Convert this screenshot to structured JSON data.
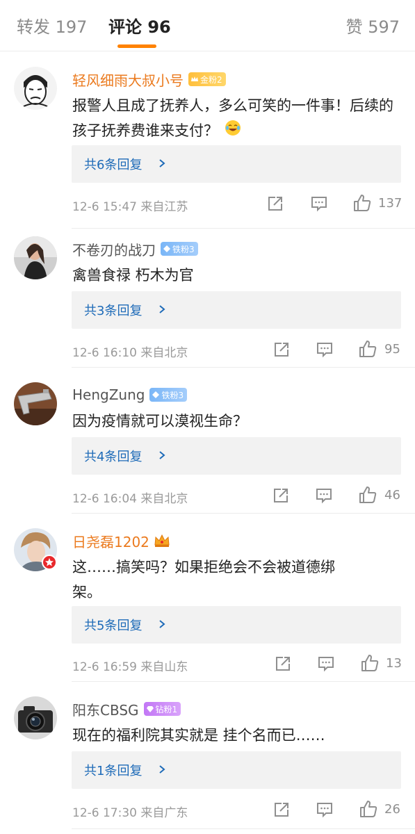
{
  "tabs": {
    "repost": "转发 197",
    "comments": "评论 96",
    "likes": "赞 597",
    "accent": "#ff8200"
  },
  "comments": [
    {
      "username": "轻风细雨大叔小号",
      "badge": "金粉2",
      "badge_type": "gold",
      "text": "报警人且成了抚养人，多么可笑的一件事！后续的孩子抚养费谁来支付？",
      "emoji": "laugh-cry-emoji",
      "replies": "共6条回复",
      "meta": "12-6 15:47 来自江苏",
      "likes": "137"
    },
    {
      "username": "不卷刃的战刀",
      "badge": "铁粉3",
      "badge_type": "iron",
      "text": "禽兽食禄 朽木为官",
      "replies": "共3条回复",
      "meta": "12-6 16:10 来自北京",
      "likes": "95"
    },
    {
      "username": "HengZung",
      "badge": "铁粉3",
      "badge_type": "iron",
      "text": "因为疫情就可以漠视生命？",
      "replies": "共4条回复",
      "meta": "12-6 16:04 来自北京",
      "likes": "46"
    },
    {
      "username": "日尧磊1202",
      "badge_type": "crown",
      "text_line1": "这……搞笑吗？如果拒绝会不会被道德绑",
      "text_line2": "架。",
      "replies": "共5条回复",
      "meta": "12-6 16:59 来自山东",
      "likes": "13"
    },
    {
      "username": "阳东CBSG",
      "badge": "钻粉1",
      "badge_type": "diamond",
      "text": "现在的福利院其实就是 挂个名而已……",
      "replies": "共1条回复",
      "meta": "12-6 17:30 来自广东",
      "likes": "26"
    }
  ]
}
